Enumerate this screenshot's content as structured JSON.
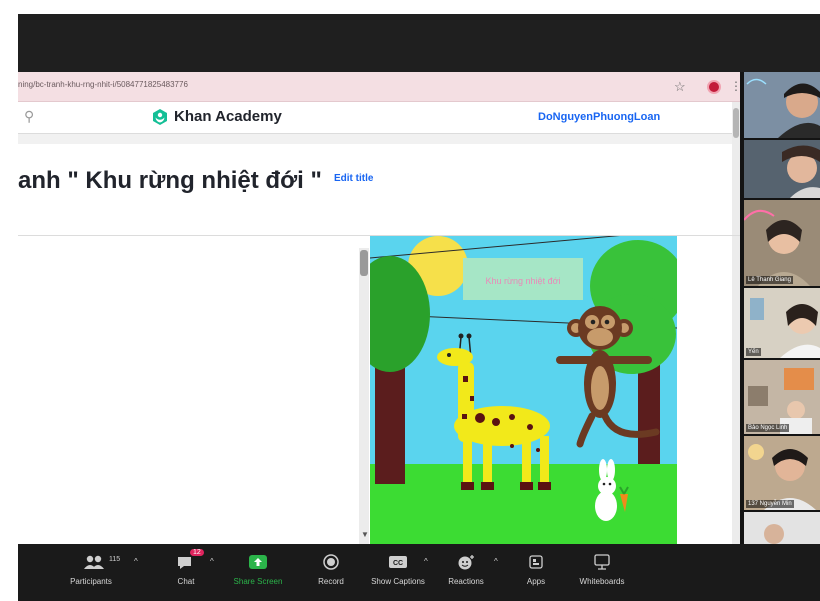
{
  "browser": {
    "url": "ning/bc-tranh-khu-rng-nhit-i/5084771825483776",
    "site_name": "Khan Academy",
    "username": "DoNguyenPhuongLoan"
  },
  "project": {
    "title": "anh \" Khu rừng nhiệt đới \"",
    "edit_title_label": "Edit title"
  },
  "canvas": {
    "sign_text": "Khu rừng nhiệt đới"
  },
  "toolbar": {
    "participants_label": "Participants",
    "participants_count": "115",
    "chat_label": "Chat",
    "chat_badge": "12",
    "share_label": "Share Screen",
    "record_label": "Record",
    "captions_label": "Show Captions",
    "reactions_label": "Reactions",
    "apps_label": "Apps",
    "whiteboards_label": "Whiteboards"
  },
  "gallery": {
    "tile3_name": "Lê Thanh Giang",
    "tile4_name": "Yến",
    "tile5_name": "Bảo Ngọc Linh",
    "tile6_name": "137 Nguyễn Min"
  },
  "colors": {
    "url_bar": "#f4dfe3",
    "ka_green": "#14bf96",
    "ka_blue": "#1865f2",
    "sky": "#5ad4ee",
    "grass": "#3cdc33",
    "toolbar_bg": "#1a1a1a",
    "share_green": "#2bb44a",
    "chat_badge": "#e0245e"
  }
}
